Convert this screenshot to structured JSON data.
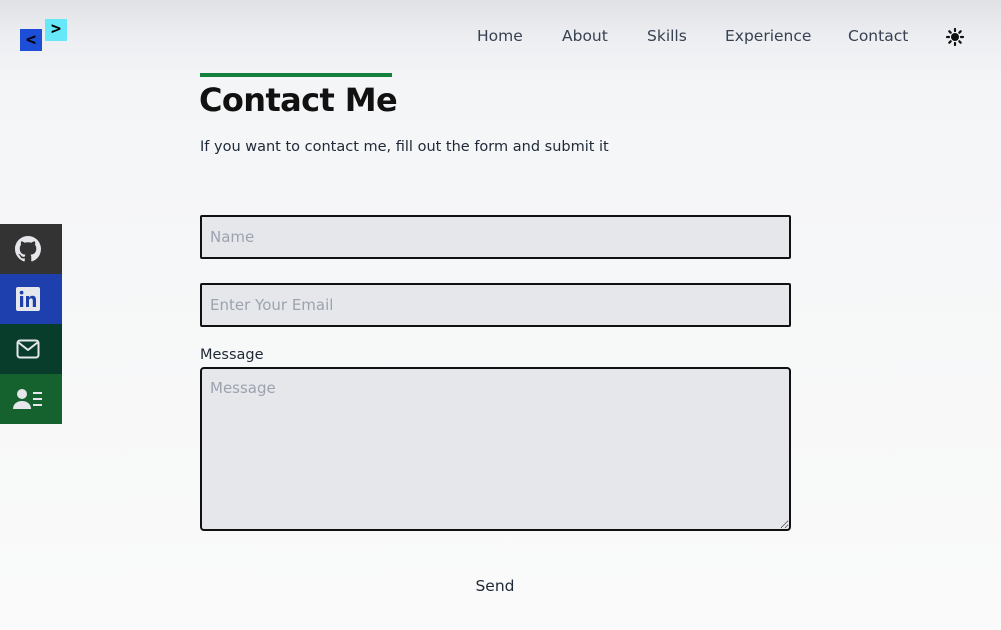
{
  "header": {
    "logo": {
      "left_glyph": "<",
      "right_glyph": ">"
    },
    "nav": [
      {
        "label": "Home"
      },
      {
        "label": "About"
      },
      {
        "label": "Skills"
      },
      {
        "label": "Experience"
      },
      {
        "label": "Contact"
      }
    ],
    "theme_toggle_icon": "sun-icon"
  },
  "social": [
    {
      "icon": "github-icon",
      "color": "#333333"
    },
    {
      "icon": "linkedin-icon",
      "color": "#1e40af"
    },
    {
      "icon": "mail-icon",
      "color": "#083d2c"
    },
    {
      "icon": "resume-icon",
      "color": "#15622f"
    }
  ],
  "contact": {
    "title": "Contact Me",
    "subtitle": "If you want to contact me, fill out the form and submit it",
    "name_placeholder": "Name",
    "email_placeholder": "Enter Your Email",
    "message_label": "Message",
    "message_placeholder": "Message",
    "send_label": "Send"
  },
  "colors": {
    "accent": "#15803d",
    "input_bg": "#e5e7eb"
  }
}
